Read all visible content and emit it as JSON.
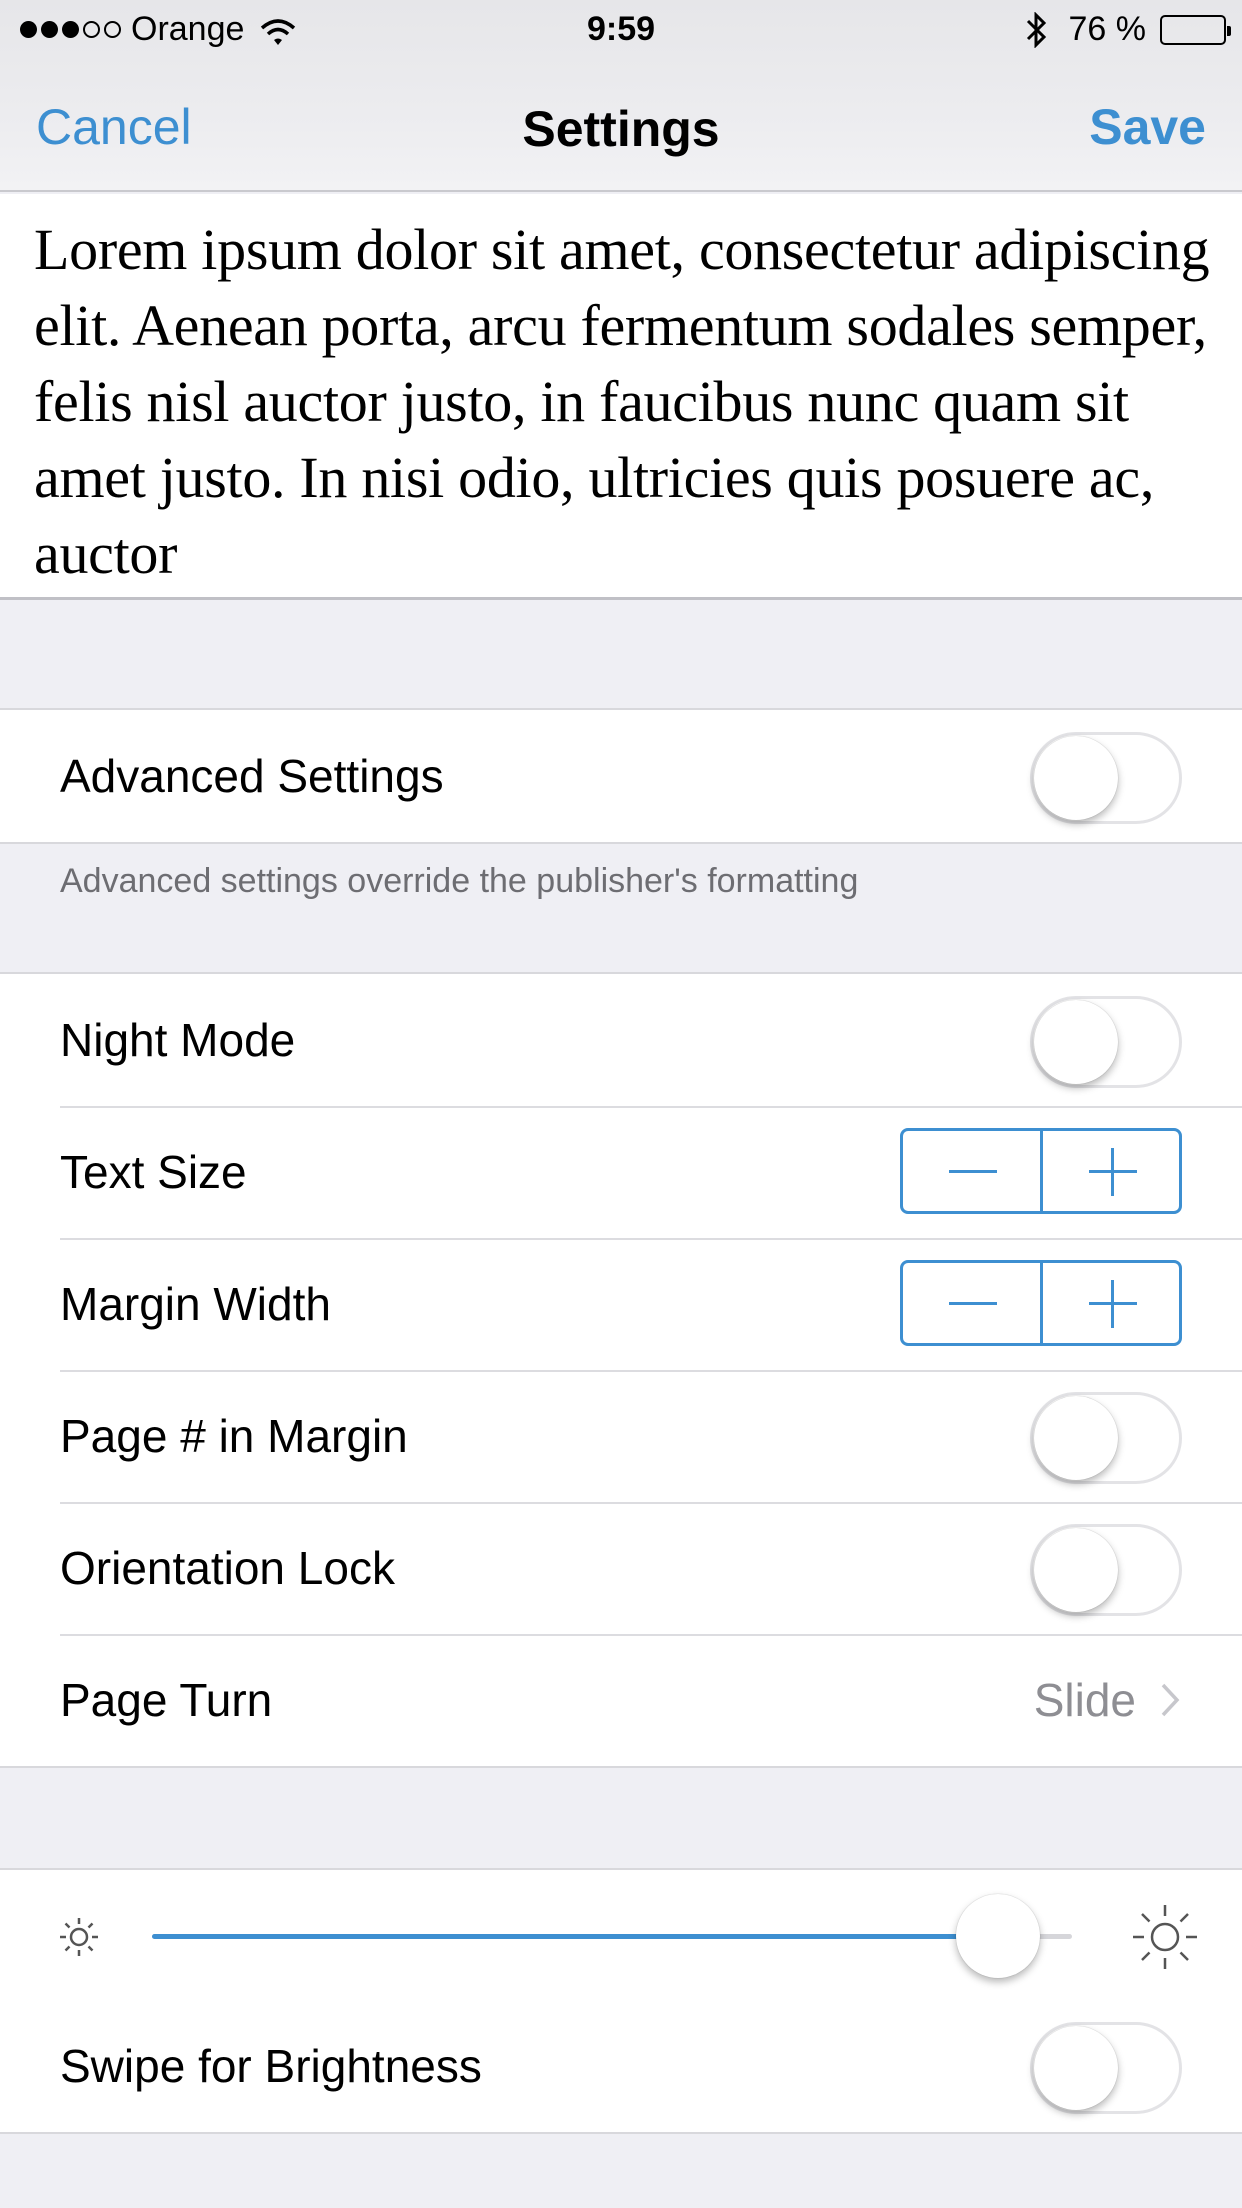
{
  "status_bar": {
    "signal_dots": [
      "on",
      "on",
      "on",
      "off",
      "off"
    ],
    "carrier": "Orange",
    "wifi_icon": "wifi-icon",
    "time": "9:59",
    "bluetooth_icon": "bluetooth-icon",
    "battery_percent": "76 %",
    "battery_level": 0.76
  },
  "nav": {
    "cancel_label": "Cancel",
    "title": "Settings",
    "save_label": "Save"
  },
  "preview": {
    "text": "Lorem ipsum dolor sit amet, consectetur adipiscing elit. Aenean porta, arcu fermentum sodales semper, felis nisl auctor justo, in faucibus nunc quam sit amet justo. In nisi odio, ultricies quis posuere ac, auctor"
  },
  "advanced": {
    "label": "Advanced Settings",
    "on": false,
    "footer": "Advanced settings override the publisher's formatting"
  },
  "settings": {
    "night_mode": {
      "label": "Night Mode",
      "on": false
    },
    "text_size": {
      "label": "Text Size",
      "minus_icon": "minus-icon",
      "plus_icon": "plus-icon"
    },
    "margin_width": {
      "label": "Margin Width",
      "minus_icon": "minus-icon",
      "plus_icon": "plus-icon"
    },
    "page_number": {
      "label": "Page # in Margin",
      "on": false
    },
    "orientation_lock": {
      "label": "Orientation Lock",
      "on": false
    },
    "page_turn": {
      "label": "Page Turn",
      "value": "Slide",
      "chevron_icon": "chevron-right-icon"
    }
  },
  "brightness": {
    "level": 0.92,
    "min_icon": "sun-small-icon",
    "max_icon": "sun-large-icon",
    "swipe_label": "Swipe for Brightness",
    "swipe_on": false
  },
  "colors": {
    "accent": "#3d8fd1",
    "background": "#efeff4",
    "secondary_text": "#8e8e93"
  }
}
